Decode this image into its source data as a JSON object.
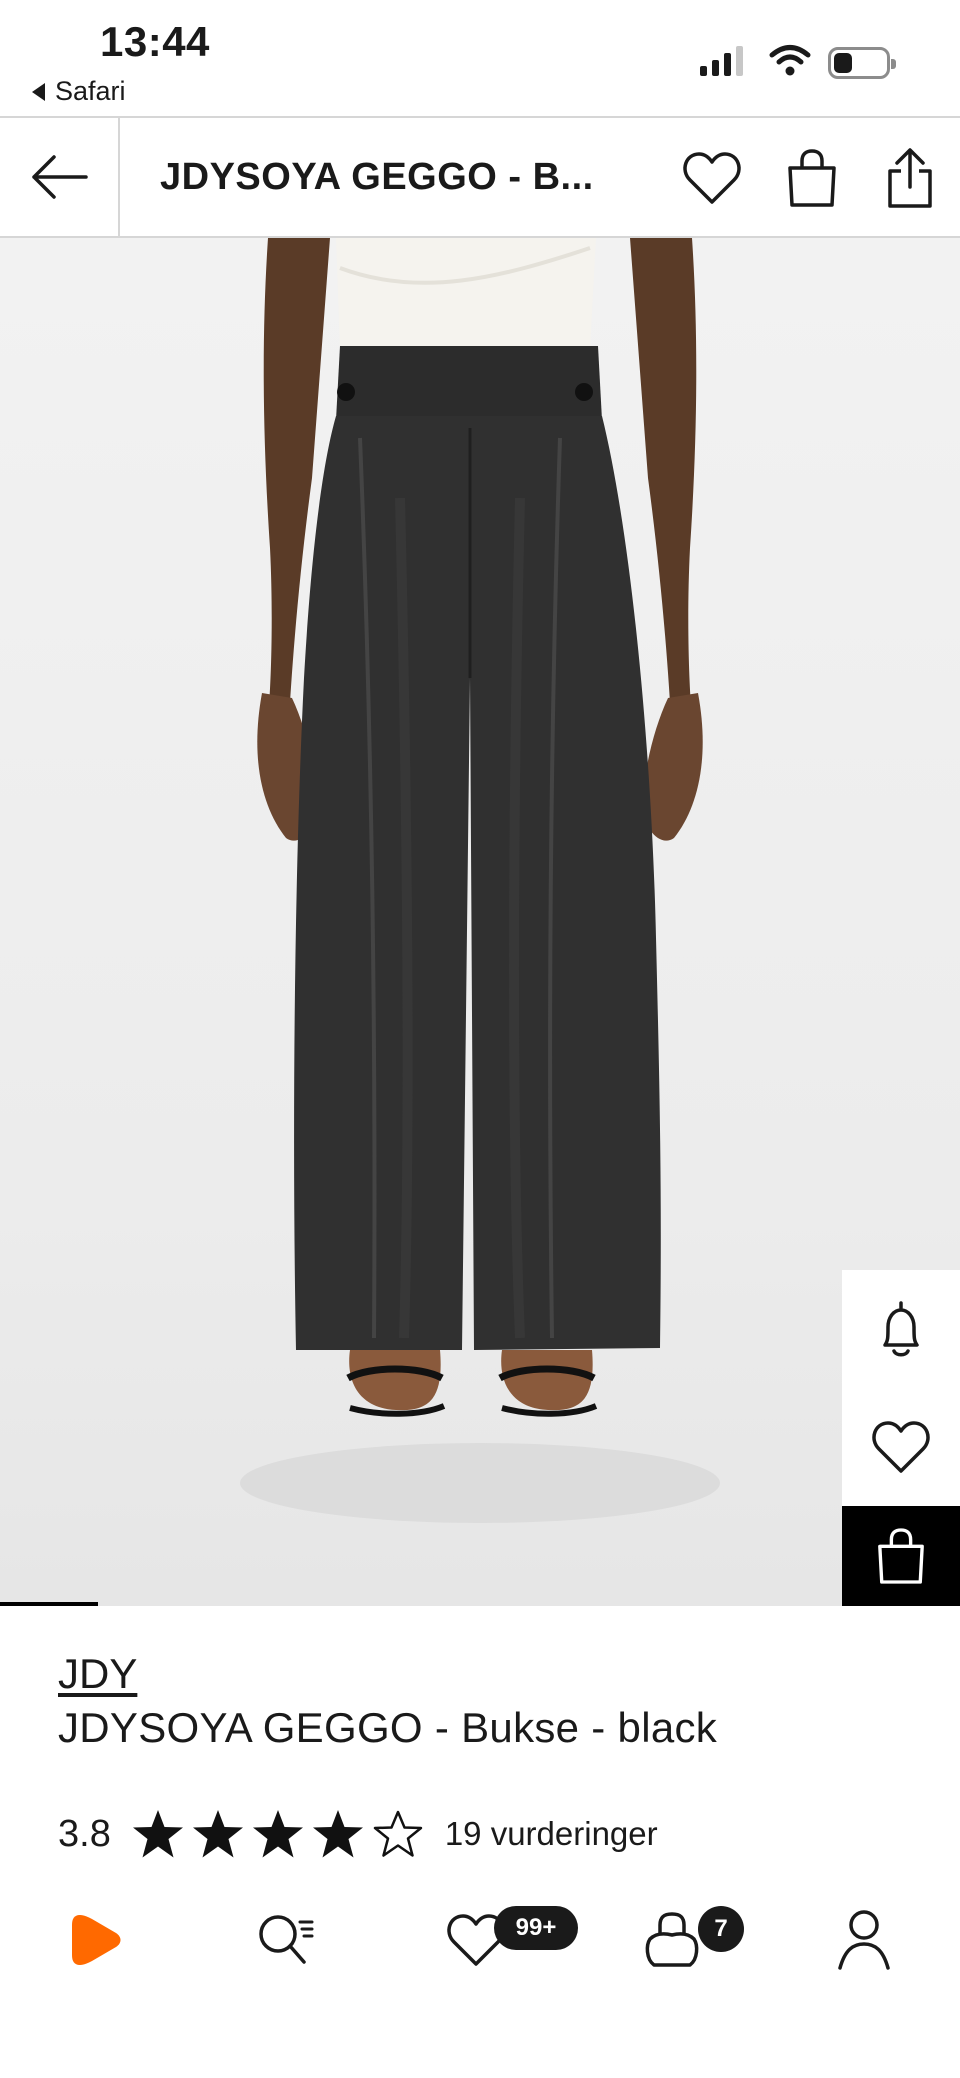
{
  "status_bar": {
    "time": "13:44",
    "back_app": "Safari",
    "icons": [
      "signal-icon",
      "wifi-icon",
      "battery-icon"
    ]
  },
  "header": {
    "title": "JDYSOYA GEGGO - B...",
    "icons": [
      "back-arrow-icon",
      "heart-icon",
      "shopping-bag-icon",
      "share-icon"
    ]
  },
  "image": {
    "side_actions": [
      "bell-icon",
      "heart-icon",
      "shopping-bag-icon"
    ],
    "similar_icon": "sparkle-crop-icon"
  },
  "product": {
    "brand": "JDY",
    "name": "JDYSOYA GEGGO - Bukse - black",
    "rating": 3.8,
    "rating_text": "3.8",
    "review_count_text": "19 vurderinger"
  },
  "bottom_nav": {
    "wishlist_badge": "99+",
    "cart_badge": "7",
    "icons": [
      "home-logo-icon",
      "search-icon",
      "wishlist-icon",
      "cart-icon",
      "profile-icon"
    ]
  },
  "colors": {
    "brand_orange": "#ff6900",
    "text": "#1a1a1a",
    "divider": "#d6d6d6"
  }
}
